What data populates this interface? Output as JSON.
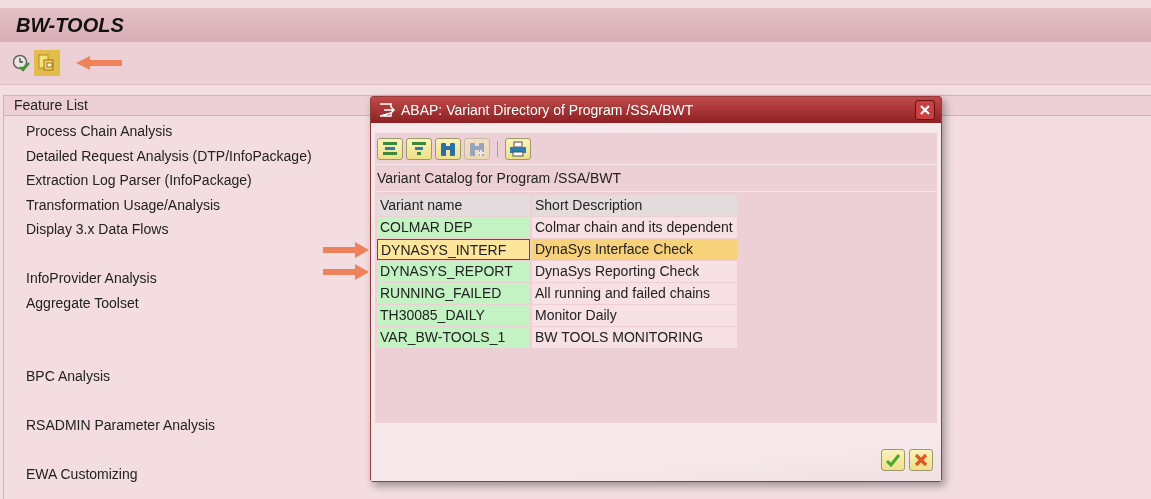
{
  "window": {
    "title": "BW-TOOLS"
  },
  "toolbar": [
    {
      "highlighted": false,
      "marked": false
    },
    {
      "highlighted": true,
      "marked": true
    }
  ],
  "feature_list": {
    "title": "Feature List",
    "items": [
      {
        "kind": "feature",
        "label": "Process Chain Analysis"
      },
      {
        "kind": "feature",
        "label": "Detailed Request Analysis (DTP/InfoPackage)"
      },
      {
        "kind": "feature",
        "label": "Extraction Log Parser (InfoPackage)"
      },
      {
        "kind": "feature",
        "label": "Transformation Usage/Analysis"
      },
      {
        "kind": "feature",
        "label": "Display 3.x Data Flows"
      },
      {
        "kind": "blank"
      },
      {
        "kind": "feature",
        "label": "InfoProvider Analysis"
      },
      {
        "kind": "feature",
        "label": "Aggregate Toolset"
      },
      {
        "kind": "blank"
      },
      {
        "kind": "blank"
      },
      {
        "kind": "feature",
        "label": "BPC Analysis"
      },
      {
        "kind": "blank"
      },
      {
        "kind": "feature",
        "label": "RSADMIN Parameter Analysis"
      },
      {
        "kind": "blank"
      },
      {
        "kind": "feature",
        "label": "EWA Customizing"
      }
    ]
  },
  "dialog": {
    "title": "ABAP: Variant Directory of Program /SSA/BWT",
    "tools": [
      {
        "disabled": false
      },
      {
        "disabled": false
      },
      {
        "disabled": false
      },
      {
        "disabled": true
      },
      {
        "disabled": false
      }
    ],
    "caption": "Variant Catalog for Program /SSA/BWT",
    "columns": [
      "Variant name",
      "Short Description"
    ],
    "rows": [
      {
        "name": "COLMAR DEP",
        "description": "Colmar chain and its dependent",
        "selected": false,
        "marked": false
      },
      {
        "name": "DYNASYS_INTERF",
        "description": "DynaSys Interface Check",
        "selected": true,
        "marked": true
      },
      {
        "name": "DYNASYS_REPORT",
        "description": "DynaSys Reporting Check",
        "selected": false,
        "marked": true
      },
      {
        "name": "RUNNING_FAILED",
        "description": "All running and failed chains",
        "selected": false,
        "marked": false
      },
      {
        "name": "TH30085_DAILY",
        "description": "Monitor Daily",
        "selected": false,
        "marked": false
      },
      {
        "name": "VAR_BW-TOOLS_1",
        "description": "BW TOOLS MONITORING",
        "selected": false,
        "marked": false
      }
    ],
    "buttons": [
      {
        "kind": "ok"
      },
      {
        "kind": "cancel"
      }
    ]
  }
}
